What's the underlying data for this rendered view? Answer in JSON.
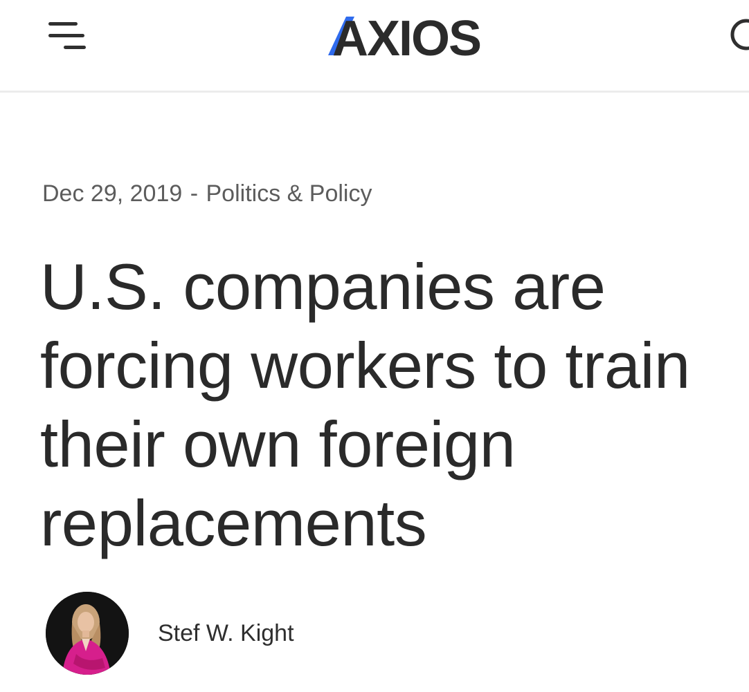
{
  "header": {
    "logo_text": "AXIOS",
    "menu_icon": "menu-icon",
    "search_icon": "search-icon",
    "brand_accent": "#2f6bed",
    "brand_dark": "#2b2b2b"
  },
  "article": {
    "date": "Dec 29, 2019",
    "separator": "-",
    "category": "Politics & Policy",
    "headline_lines": [
      "U.S. companies are",
      "forcing workers to train",
      "their own foreign",
      "replacements"
    ],
    "author": {
      "name": "Stef W. Kight",
      "avatar_icon": "author-photo"
    }
  }
}
